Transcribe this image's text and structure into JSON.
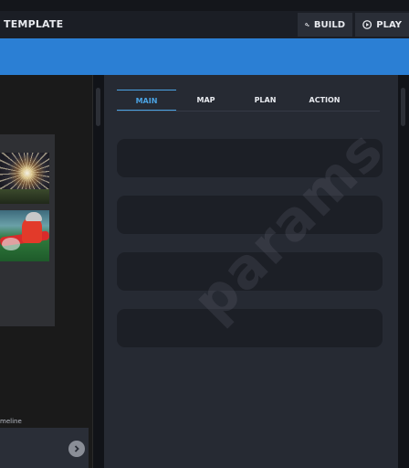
{
  "app": {
    "title": "TEMPLATE"
  },
  "toolbar": {
    "build_label": "BUILD",
    "build_icon": "gears-icon",
    "play_label": "PLAY",
    "play_icon": "play-circle-icon"
  },
  "banner": {
    "color": "#2b7fd4"
  },
  "tabs": [
    {
      "label": "MAIN",
      "active": true
    },
    {
      "label": "MAP",
      "active": false
    },
    {
      "label": "PLAN",
      "active": false
    },
    {
      "label": "ACTION",
      "active": false
    }
  ],
  "panel": {
    "watermark": "params"
  },
  "left": {
    "timeline_label": "meline",
    "next_icon": "chevron-right-circle-icon"
  },
  "colors": {
    "accent": "#4ba3e3",
    "banner": "#2b7fd4",
    "panel": "#262a33",
    "card": "#1c1f26"
  }
}
